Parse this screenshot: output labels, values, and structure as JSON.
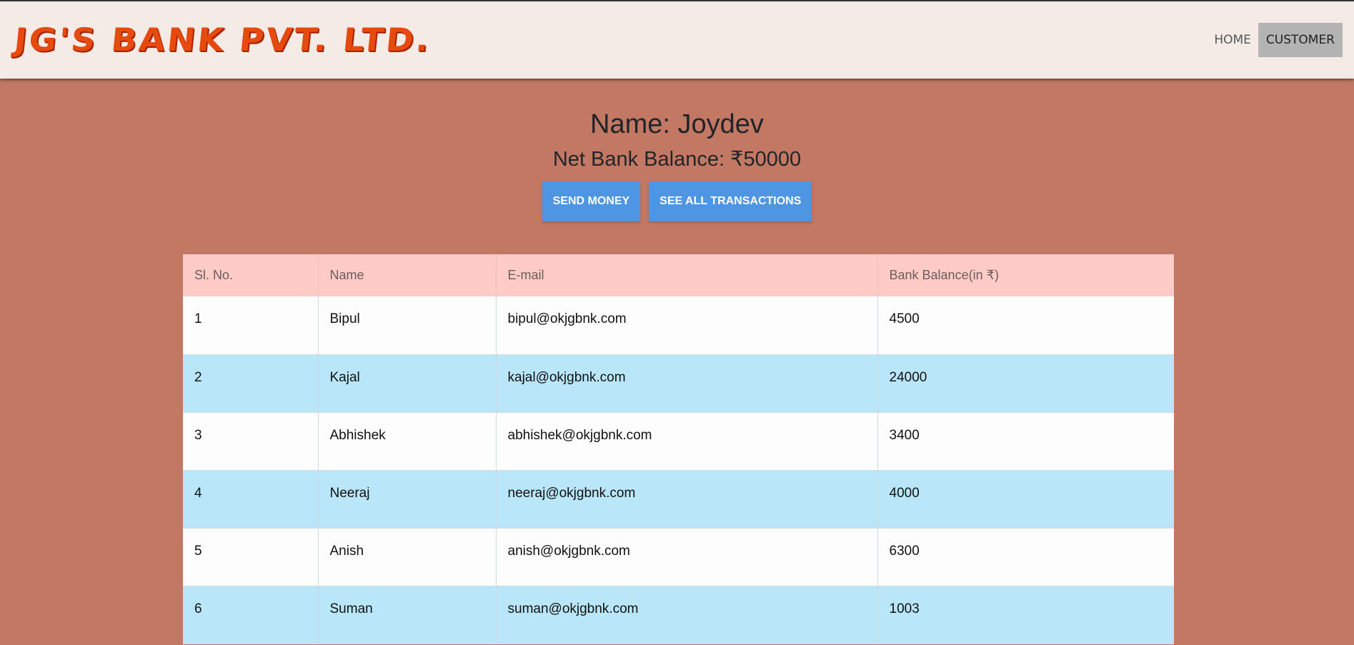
{
  "navbar": {
    "brand": "JG'S BANK PVT. LTD.",
    "links": [
      {
        "label": "HOME",
        "active": false
      },
      {
        "label": "CUSTOMER",
        "active": true
      }
    ]
  },
  "profile": {
    "name": "Name: Joydev",
    "balance": "Net Bank Balance: ₹50000"
  },
  "actions": {
    "send_money": "SEND MONEY",
    "see_all": "SEE ALL TRANSACTIONS"
  },
  "table": {
    "headers": [
      "Sl. No.",
      "Name",
      "E-mail",
      "Bank Balance(in ₹)"
    ],
    "rows": [
      [
        "1",
        "Bipul",
        "bipul@okjgbnk.com",
        "4500"
      ],
      [
        "2",
        "Kajal",
        "kajal@okjgbnk.com",
        "24000"
      ],
      [
        "3",
        "Abhishek",
        "abhishek@okjgbnk.com",
        "3400"
      ],
      [
        "4",
        "Neeraj",
        "neeraj@okjgbnk.com",
        "4000"
      ],
      [
        "5",
        "Anish",
        "anish@okjgbnk.com",
        "6300"
      ],
      [
        "6",
        "Suman",
        "suman@okjgbnk.com",
        "1003"
      ]
    ]
  },
  "colors": {
    "page_bg": "#c27863",
    "navbar_bg": "#f4ebe7",
    "brand": "#e64a0f",
    "button": "#4e95e3",
    "table_header": "#ffcbc7",
    "row_alt": "#b9e7f9"
  }
}
